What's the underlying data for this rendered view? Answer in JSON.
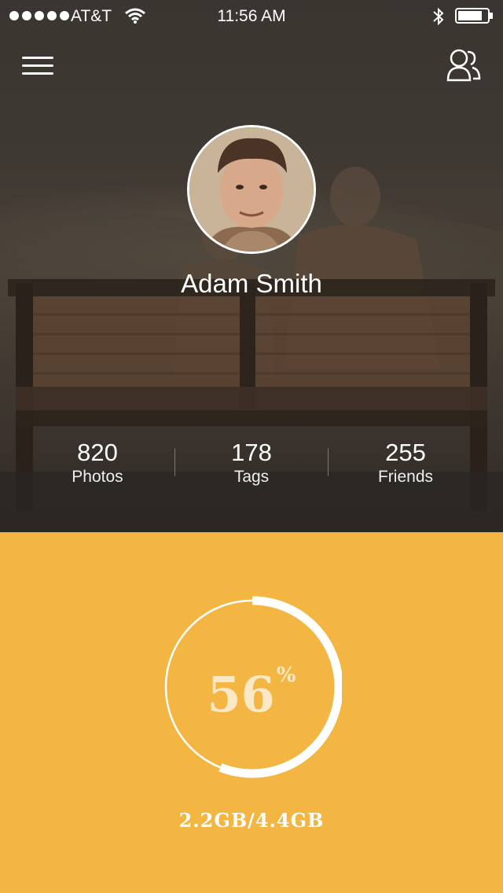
{
  "status_bar": {
    "carrier": "AT&T",
    "time": "11:56 AM"
  },
  "header": {
    "menu_icon": "hamburger-menu-icon",
    "friends_icon": "people-icon"
  },
  "profile": {
    "name": "Adam Smith",
    "stats": [
      {
        "value": "820",
        "label": "Photos"
      },
      {
        "value": "178",
        "label": "Tags"
      },
      {
        "value": "255",
        "label": "Friends"
      }
    ]
  },
  "storage": {
    "percent_value": "56",
    "percent_sign": "%",
    "percent_fraction": 0.56,
    "usage": "2.2GB/4.4GB"
  },
  "colors": {
    "accent": "#f4b642",
    "hero_dark": "#3a3530",
    "ring": "#ffffff",
    "percent_text": "#fae8c6"
  }
}
